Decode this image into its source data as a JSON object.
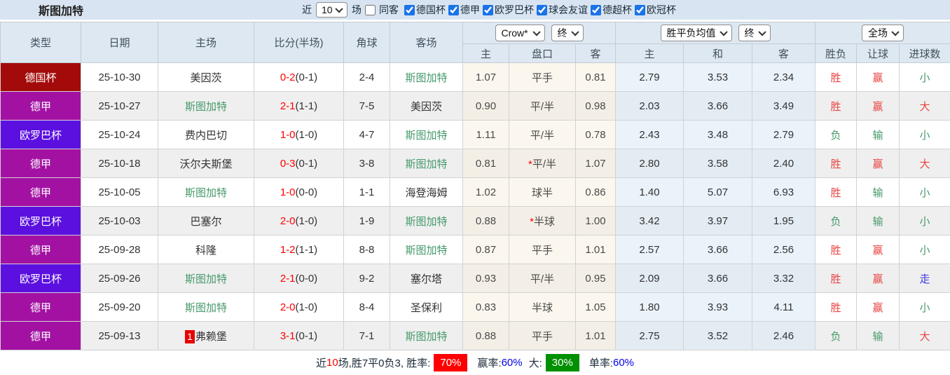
{
  "title": "斯图加特",
  "topbar": {
    "recent_label": "近",
    "recent_value": "10",
    "games_label": "场",
    "same_venue_label": "同客",
    "same_venue_checked": false,
    "leagues": [
      {
        "label": "德国杯",
        "checked": true
      },
      {
        "label": "德甲",
        "checked": true
      },
      {
        "label": "欧罗巴杯",
        "checked": true
      },
      {
        "label": "球会友谊",
        "checked": true
      },
      {
        "label": "德超杯",
        "checked": true
      },
      {
        "label": "欧冠杯",
        "checked": true
      }
    ]
  },
  "table": {
    "columns": [
      "类型",
      "日期",
      "主场",
      "比分(半场)",
      "角球",
      "客场"
    ],
    "selects": {
      "asian_company": "Crow*",
      "asian_time": "终",
      "euro_type": "胜平负均值",
      "euro_time": "终",
      "result_scope": "全场"
    },
    "subheaders": [
      "主",
      "盘口",
      "客",
      "主",
      "和",
      "客",
      "胜负",
      "让球",
      "进球数"
    ],
    "type_colors": {
      "德国杯": "#a30b0b",
      "德甲": "#a311a3",
      "欧罗巴杯": "#5b10e0"
    },
    "rows": [
      {
        "type": "德国杯",
        "type_color": "#a30b0b",
        "date": "25-10-30",
        "badge": "",
        "home": "美因茨",
        "home_highlight": false,
        "score": "0-2",
        "half": "(0-1)",
        "corner": "2-4",
        "away": "斯图加特",
        "away_highlight": true,
        "asian_home": "1.07",
        "handicap_star": false,
        "handicap": "平手",
        "asian_away": "0.81",
        "euro_home": "2.79",
        "euro_draw": "3.53",
        "euro_away": "2.34",
        "wdl": {
          "text": "胜",
          "color": "red"
        },
        "let": {
          "text": "赢",
          "color": "red"
        },
        "goal": {
          "text": "小",
          "color": "green"
        }
      },
      {
        "type": "德甲",
        "type_color": "#a311a3",
        "date": "25-10-27",
        "badge": "",
        "home": "斯图加特",
        "home_highlight": true,
        "score": "2-1",
        "half": "(1-1)",
        "corner": "7-5",
        "away": "美因茨",
        "away_highlight": false,
        "asian_home": "0.90",
        "handicap_star": false,
        "handicap": "平/半",
        "asian_away": "0.98",
        "euro_home": "2.03",
        "euro_draw": "3.66",
        "euro_away": "3.49",
        "wdl": {
          "text": "胜",
          "color": "red"
        },
        "let": {
          "text": "赢",
          "color": "red"
        },
        "goal": {
          "text": "大",
          "color": "red"
        }
      },
      {
        "type": "欧罗巴杯",
        "type_color": "#5b10e0",
        "date": "25-10-24",
        "badge": "",
        "home": "费内巴切",
        "home_highlight": false,
        "score": "1-0",
        "half": "(1-0)",
        "corner": "4-7",
        "away": "斯图加特",
        "away_highlight": true,
        "asian_home": "1.11",
        "handicap_star": false,
        "handicap": "平/半",
        "asian_away": "0.78",
        "euro_home": "2.43",
        "euro_draw": "3.48",
        "euro_away": "2.79",
        "wdl": {
          "text": "负",
          "color": "green"
        },
        "let": {
          "text": "输",
          "color": "green"
        },
        "goal": {
          "text": "小",
          "color": "green"
        }
      },
      {
        "type": "德甲",
        "type_color": "#a311a3",
        "date": "25-10-18",
        "badge": "",
        "home": "沃尔夫斯堡",
        "home_highlight": false,
        "score": "0-3",
        "half": "(0-1)",
        "corner": "3-8",
        "away": "斯图加特",
        "away_highlight": true,
        "asian_home": "0.81",
        "handicap_star": true,
        "handicap": "平/半",
        "asian_away": "1.07",
        "euro_home": "2.80",
        "euro_draw": "3.58",
        "euro_away": "2.40",
        "wdl": {
          "text": "胜",
          "color": "red"
        },
        "let": {
          "text": "赢",
          "color": "red"
        },
        "goal": {
          "text": "大",
          "color": "red"
        }
      },
      {
        "type": "德甲",
        "type_color": "#a311a3",
        "date": "25-10-05",
        "badge": "",
        "home": "斯图加特",
        "home_highlight": true,
        "score": "1-0",
        "half": "(0-0)",
        "corner": "1-1",
        "away": "海登海姆",
        "away_highlight": false,
        "asian_home": "1.02",
        "handicap_star": false,
        "handicap": "球半",
        "asian_away": "0.86",
        "euro_home": "1.40",
        "euro_draw": "5.07",
        "euro_away": "6.93",
        "wdl": {
          "text": "胜",
          "color": "red"
        },
        "let": {
          "text": "输",
          "color": "green"
        },
        "goal": {
          "text": "小",
          "color": "green"
        }
      },
      {
        "type": "欧罗巴杯",
        "type_color": "#5b10e0",
        "date": "25-10-03",
        "badge": "",
        "home": "巴塞尔",
        "home_highlight": false,
        "score": "2-0",
        "half": "(1-0)",
        "corner": "1-9",
        "away": "斯图加特",
        "away_highlight": true,
        "asian_home": "0.88",
        "handicap_star": true,
        "handicap": "半球",
        "asian_away": "1.00",
        "euro_home": "3.42",
        "euro_draw": "3.97",
        "euro_away": "1.95",
        "wdl": {
          "text": "负",
          "color": "green"
        },
        "let": {
          "text": "输",
          "color": "green"
        },
        "goal": {
          "text": "小",
          "color": "green"
        }
      },
      {
        "type": "德甲",
        "type_color": "#a311a3",
        "date": "25-09-28",
        "badge": "",
        "home": "科隆",
        "home_highlight": false,
        "score": "1-2",
        "half": "(1-1)",
        "corner": "8-8",
        "away": "斯图加特",
        "away_highlight": true,
        "asian_home": "0.87",
        "handicap_star": false,
        "handicap": "平手",
        "asian_away": "1.01",
        "euro_home": "2.57",
        "euro_draw": "3.66",
        "euro_away": "2.56",
        "wdl": {
          "text": "胜",
          "color": "red"
        },
        "let": {
          "text": "赢",
          "color": "red"
        },
        "goal": {
          "text": "小",
          "color": "green"
        }
      },
      {
        "type": "欧罗巴杯",
        "type_color": "#5b10e0",
        "date": "25-09-26",
        "badge": "",
        "home": "斯图加特",
        "home_highlight": true,
        "score": "2-1",
        "half": "(0-0)",
        "corner": "9-2",
        "away": "塞尔塔",
        "away_highlight": false,
        "asian_home": "0.93",
        "handicap_star": false,
        "handicap": "平/半",
        "asian_away": "0.95",
        "euro_home": "2.09",
        "euro_draw": "3.66",
        "euro_away": "3.32",
        "wdl": {
          "text": "胜",
          "color": "red"
        },
        "let": {
          "text": "赢",
          "color": "red"
        },
        "goal": {
          "text": "走",
          "color": "blue"
        }
      },
      {
        "type": "德甲",
        "type_color": "#a311a3",
        "date": "25-09-20",
        "badge": "",
        "home": "斯图加特",
        "home_highlight": true,
        "score": "2-0",
        "half": "(1-0)",
        "corner": "8-4",
        "away": "圣保利",
        "away_highlight": false,
        "asian_home": "0.83",
        "handicap_star": false,
        "handicap": "半球",
        "asian_away": "1.05",
        "euro_home": "1.80",
        "euro_draw": "3.93",
        "euro_away": "4.11",
        "wdl": {
          "text": "胜",
          "color": "red"
        },
        "let": {
          "text": "赢",
          "color": "red"
        },
        "goal": {
          "text": "小",
          "color": "green"
        }
      },
      {
        "type": "德甲",
        "type_color": "#a311a3",
        "date": "25-09-13",
        "badge": "1",
        "home": "弗赖堡",
        "home_highlight": false,
        "score": "3-1",
        "half": "(0-1)",
        "corner": "7-1",
        "away": "斯图加特",
        "away_highlight": true,
        "asian_home": "0.88",
        "handicap_star": false,
        "handicap": "平手",
        "asian_away": "1.01",
        "euro_home": "2.75",
        "euro_draw": "3.52",
        "euro_away": "2.46",
        "wdl": {
          "text": "负",
          "color": "green"
        },
        "let": {
          "text": "输",
          "color": "green"
        },
        "goal": {
          "text": "大",
          "color": "red"
        }
      }
    ]
  },
  "footer": {
    "prefix": "近",
    "count": "10",
    "mid": "场,胜7平0负3, 胜率:",
    "win_rate": "70%",
    "win_odds_label": "赢率:",
    "win_odds_value": "60%",
    "big_label": "大:",
    "big_value": "30%",
    "single_label": "单率:",
    "single_value": "60%",
    "accent_red": "#ff0000",
    "accent_green": "#009000",
    "accent_blue": "#0000ee"
  }
}
